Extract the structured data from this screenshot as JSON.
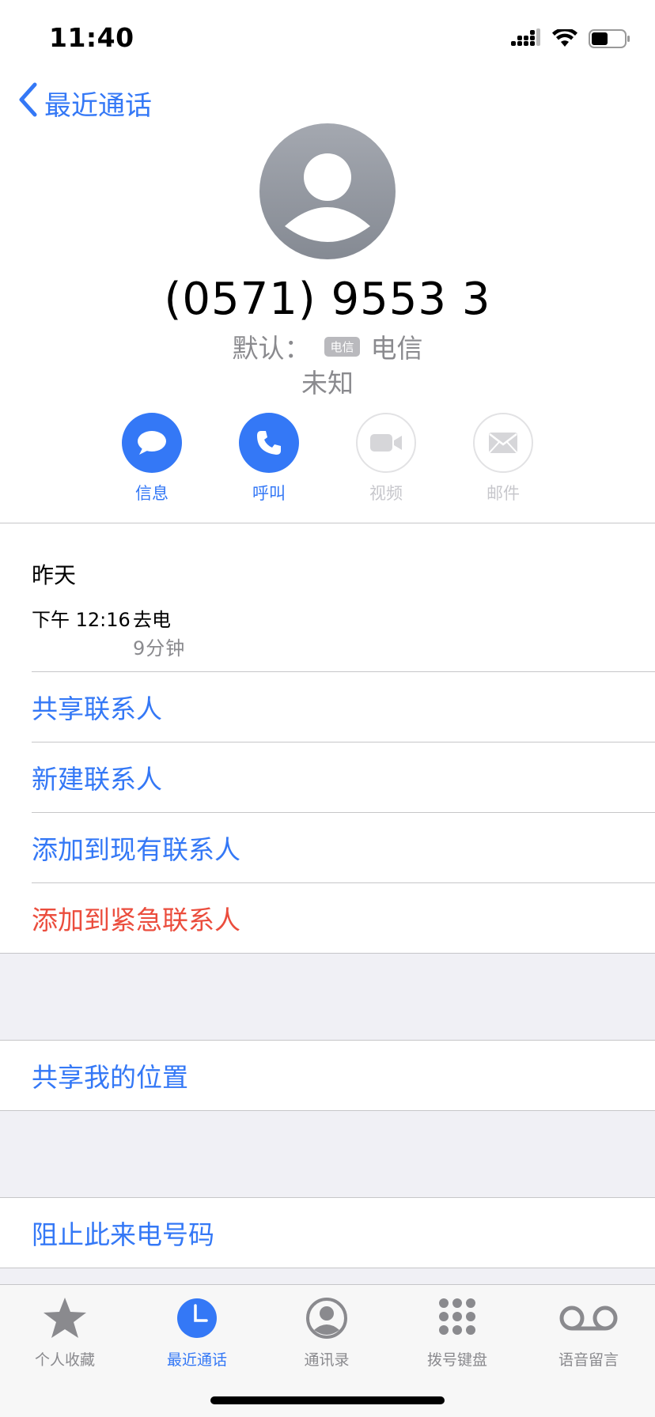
{
  "status": {
    "time": "11:40",
    "icons": [
      "cellular-signal-icon",
      "wifi-icon",
      "battery-icon"
    ]
  },
  "nav": {
    "back_label": "最近通话"
  },
  "contact": {
    "number": "(0571) 9553 3",
    "default_label": "默认：",
    "sim_badge": "电信",
    "carrier": "电信",
    "label": "未知"
  },
  "actions": [
    {
      "label": "信息",
      "icon": "message-icon",
      "enabled": true
    },
    {
      "label": "呼叫",
      "icon": "phone-icon",
      "enabled": true
    },
    {
      "label": "视频",
      "icon": "video-icon",
      "enabled": false
    },
    {
      "label": "邮件",
      "icon": "mail-icon",
      "enabled": false
    }
  ],
  "call_history": {
    "day": "昨天",
    "entries": [
      {
        "time": "下午 12:16",
        "type": "去电",
        "duration": "9分钟"
      }
    ]
  },
  "contact_options": [
    {
      "label": "共享联系人",
      "color": "#3478f6"
    },
    {
      "label": "新建联系人",
      "color": "#3478f6"
    },
    {
      "label": "添加到现有联系人",
      "color": "#3478f6"
    },
    {
      "label": "添加到紧急联系人",
      "color": "#eb4d3d"
    }
  ],
  "location_option": {
    "label": "共享我的位置"
  },
  "block_option": {
    "label": "阻止此来电号码"
  },
  "tabs": [
    {
      "label": "个人收藏",
      "icon": "star-icon",
      "active": false
    },
    {
      "label": "最近通话",
      "icon": "clock-icon",
      "active": true
    },
    {
      "label": "通讯录",
      "icon": "person-circle-icon",
      "active": false
    },
    {
      "label": "拨号键盘",
      "icon": "keypad-icon",
      "active": false
    },
    {
      "label": "语音留言",
      "icon": "voicemail-icon",
      "active": false
    }
  ],
  "colors": {
    "accent": "#3478f6",
    "destructive": "#eb4d3d",
    "secondary_text": "#8a8a8e",
    "disabled": "#c7c7cc",
    "grouped_background": "#f0f0f5"
  }
}
